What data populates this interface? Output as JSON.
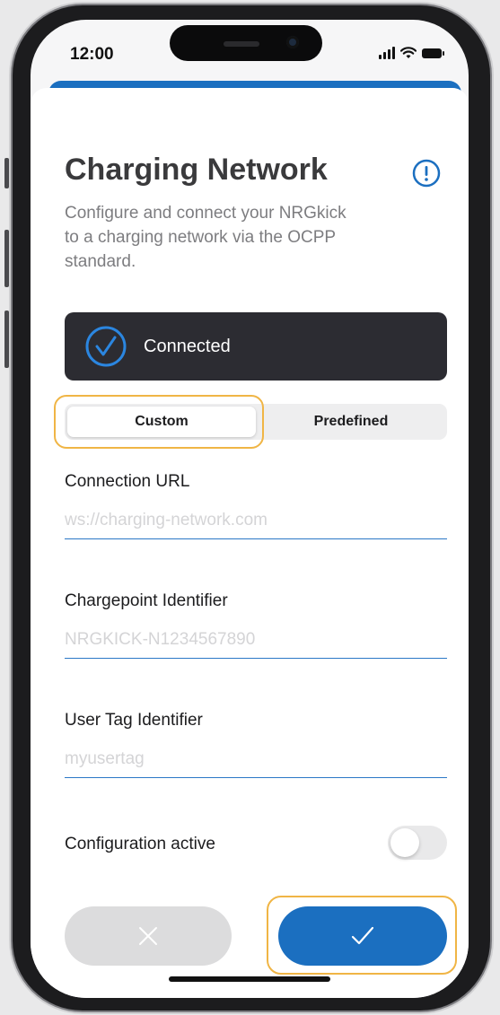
{
  "status_bar": {
    "time": "12:00"
  },
  "header": {
    "title": "Charging Network",
    "subtitle": "Configure and connect your NRGkick to a charging network via the OCPP standard."
  },
  "connection_status": {
    "label": "Connected",
    "icon": "check-circle-icon"
  },
  "mode_selector": {
    "options": [
      "Custom",
      "Predefined"
    ],
    "selected": "Custom"
  },
  "fields": [
    {
      "label": "Connection URL",
      "value": "",
      "placeholder": "ws://charging-network.com"
    },
    {
      "label": "Chargepoint Identifier",
      "value": "",
      "placeholder": "NRGKICK-N1234567890"
    },
    {
      "label": "User Tag Identifier",
      "value": "",
      "placeholder": "myusertag"
    }
  ],
  "configuration_toggle": {
    "label": "Configuration active",
    "on": false
  },
  "actions": {
    "cancel_icon": "close-icon",
    "confirm_icon": "checkmark-icon"
  },
  "colors": {
    "accent": "#1b6fc0",
    "status_card": "#2c2c32",
    "highlight": "#f0b545",
    "input_underline": "#2b78c6"
  }
}
